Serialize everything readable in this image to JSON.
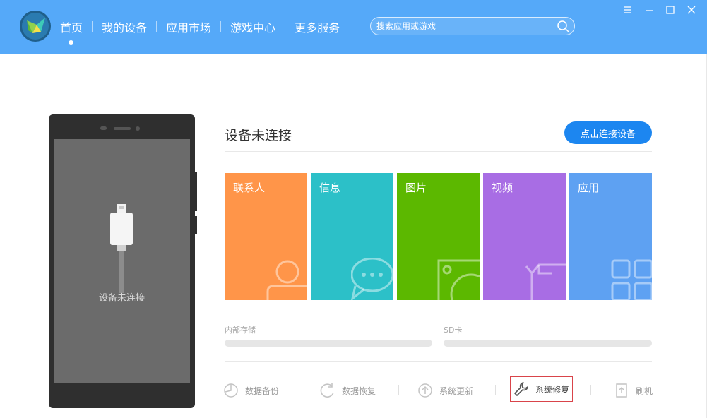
{
  "nav": {
    "items": [
      {
        "label": "首页"
      },
      {
        "label": "我的设备"
      },
      {
        "label": "应用市场"
      },
      {
        "label": "游戏中心"
      },
      {
        "label": "更多服务"
      }
    ],
    "active_index": 0
  },
  "search": {
    "placeholder": "搜索应用或游戏"
  },
  "phone": {
    "status": "设备未连接"
  },
  "main": {
    "title": "设备未连接",
    "connect_button": "点击连接设备",
    "tiles": [
      {
        "label": "联系人",
        "color": "#ff9549",
        "icon": "contact-icon"
      },
      {
        "label": "信息",
        "color": "#2cc0c8",
        "icon": "message-icon"
      },
      {
        "label": "图片",
        "color": "#5cb800",
        "icon": "picture-icon"
      },
      {
        "label": "视频",
        "color": "#a86de4",
        "icon": "video-icon"
      },
      {
        "label": "应用",
        "color": "#5ea1f2",
        "icon": "apps-icon"
      }
    ],
    "storage": [
      {
        "label": "内部存储",
        "fill": 0
      },
      {
        "label": "SD卡",
        "fill": 0
      }
    ],
    "tools": [
      {
        "label": "数据备份",
        "icon": "backup-icon"
      },
      {
        "label": "数据恢复",
        "icon": "restore-icon"
      },
      {
        "label": "系统更新",
        "icon": "update-icon"
      },
      {
        "label": "系统修复",
        "icon": "wrench-icon",
        "highlighted": true
      },
      {
        "label": "刷机",
        "icon": "flash-icon"
      }
    ]
  },
  "colors": {
    "topbar": "#55a9f9",
    "accent": "#1c86f0",
    "highlight_border": "#d9444a"
  }
}
